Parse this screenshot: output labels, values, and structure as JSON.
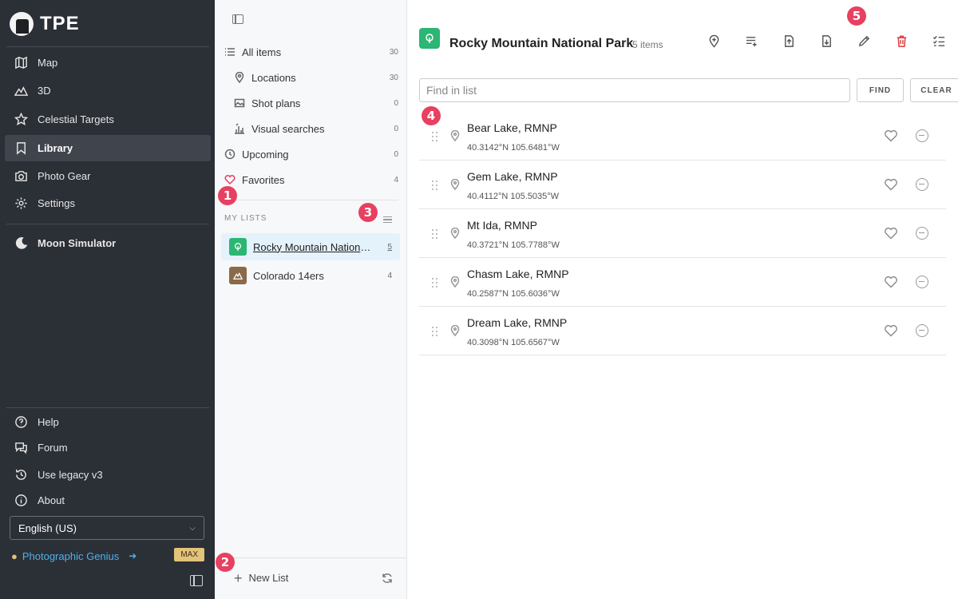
{
  "app": {
    "brand": "TPE"
  },
  "nav": {
    "items": [
      {
        "label": "Map",
        "icon": "map-icon"
      },
      {
        "label": "3D",
        "icon": "mountains-icon"
      },
      {
        "label": "Celestial Targets",
        "icon": "star-icon"
      },
      {
        "label": "Library",
        "icon": "bookmark-icon",
        "active": true
      },
      {
        "label": "Photo Gear",
        "icon": "camera-icon"
      },
      {
        "label": "Settings",
        "icon": "gear-icon"
      },
      {
        "label": "Moon Simulator",
        "icon": "moon-icon"
      }
    ],
    "bottom_items": [
      {
        "label": "Help",
        "icon": "help-icon"
      },
      {
        "label": "Forum",
        "icon": "forum-icon"
      },
      {
        "label": "Use legacy v3",
        "icon": "history-icon"
      },
      {
        "label": "About",
        "icon": "info-icon"
      }
    ],
    "language": "English (US)",
    "user_name": "Photographic Genius",
    "plan_badge": "MAX"
  },
  "library": {
    "categories": [
      {
        "label": "All items",
        "count": "30"
      },
      {
        "label": "Locations",
        "count": "30"
      },
      {
        "label": "Shot plans",
        "count": "0"
      },
      {
        "label": "Visual searches",
        "count": "0"
      },
      {
        "label": "Upcoming",
        "count": "0"
      },
      {
        "label": "Favorites",
        "count": "4"
      }
    ],
    "my_lists_label": "MY LISTS",
    "lists": [
      {
        "label": "Rocky Mountain National Park",
        "count": "5",
        "color": "#2bb673",
        "active": true
      },
      {
        "label": "Colorado 14ers",
        "count": "4",
        "color": "#8a6a4a"
      }
    ],
    "new_list_label": "New List"
  },
  "main": {
    "title": "Rocky Mountain National Park",
    "item_count": "5 items",
    "search_placeholder": "Find in list",
    "find_label": "FIND",
    "clear_label": "CLEAR",
    "items": [
      {
        "name": "Bear Lake, RMNP",
        "coords": "40.3142°N 105.6481°W"
      },
      {
        "name": "Gem Lake, RMNP",
        "coords": "40.4112°N 105.5035°W"
      },
      {
        "name": "Mt Ida, RMNP",
        "coords": "40.3721°N 105.7788°W"
      },
      {
        "name": "Chasm Lake, RMNP",
        "coords": "40.2587°N 105.6036°W"
      },
      {
        "name": "Dream Lake, RMNP",
        "coords": "40.3098°N 105.6567°W"
      }
    ]
  },
  "callouts": [
    "1",
    "2",
    "3",
    "4",
    "5"
  ],
  "colors": {
    "sidebar": "#2b2f36",
    "accent": "#2bb673",
    "callout": "#e84060",
    "link": "#4fb0e8",
    "danger": "#d9363e"
  }
}
